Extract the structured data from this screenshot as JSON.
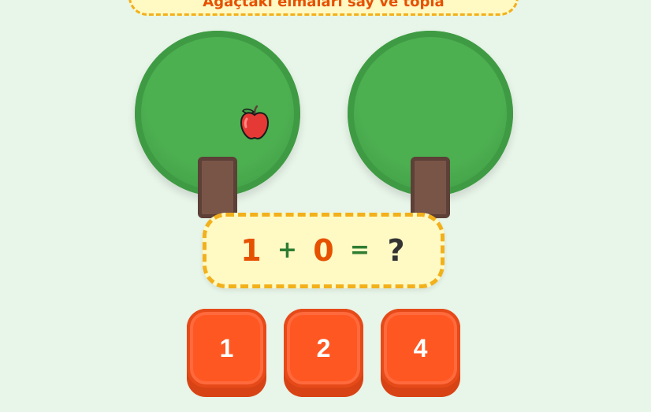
{
  "banner": {
    "text": "Ağaçtaki elmaları say ve topla"
  },
  "trees": [
    {
      "apples": 1
    },
    {
      "apples": 0
    }
  ],
  "equation": {
    "left": "1",
    "operator": "+",
    "right": "0",
    "equals": "=",
    "unknown": "?"
  },
  "answers": [
    {
      "label": "1"
    },
    {
      "label": "2"
    },
    {
      "label": "4"
    }
  ],
  "colors": {
    "background": "#e8f5e9",
    "tree_crown": "#4caf50",
    "trunk": "#795548",
    "equation_bg": "#fff9c4",
    "dash_border": "#f2b01b",
    "number": "#e65100",
    "operator": "#2e7d32",
    "button": "#ff5722"
  }
}
